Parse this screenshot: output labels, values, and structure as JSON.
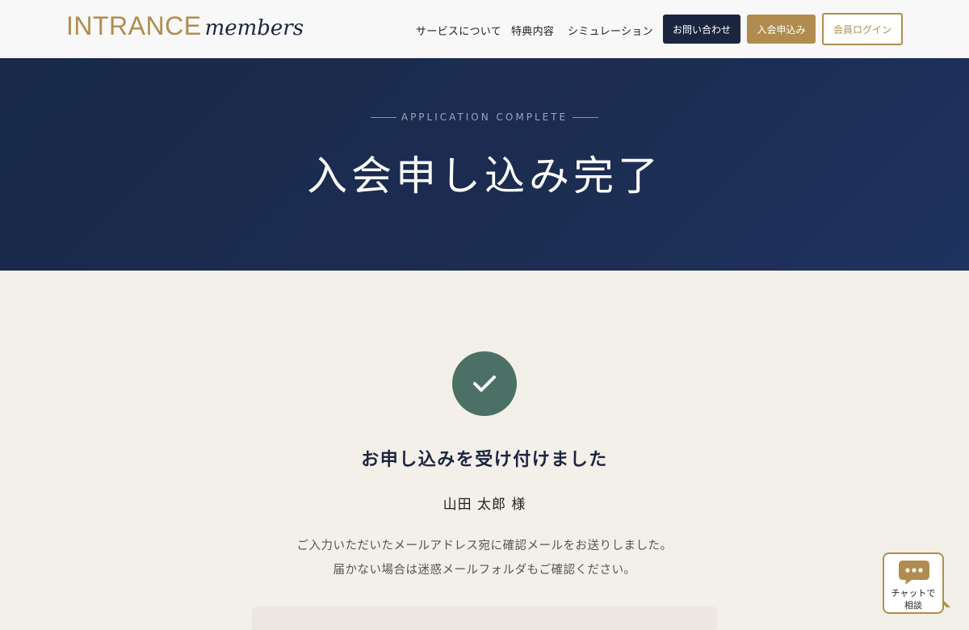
{
  "header": {
    "logo_main": "INTRANCE",
    "logo_sub": "members",
    "nav": [
      {
        "label": "サービスについて"
      },
      {
        "label": "特典内容"
      },
      {
        "label": "シミュレーション"
      }
    ],
    "contact_label": "お問い合わせ",
    "apply_label": "入会申込み",
    "login_label": "会員ログイン"
  },
  "hero": {
    "eyebrow": "APPLICATION COMPLETE",
    "title": "入会申し込み完了"
  },
  "main": {
    "check_icon": "checkmark-icon",
    "title": "お申し込みを受け付けました",
    "user_name": "山田 太郎 様",
    "message_line1": "ご入力いただいたメールアドレス宛に確認メールをお送りしました。",
    "message_line2": "届かない場合は迷惑メールフォルダもご確認ください。"
  },
  "chat": {
    "icon": "chat-bubble-icon",
    "label": "チャットで\n相談"
  },
  "colors": {
    "navy": "#1c2540",
    "gold": "#b08d4f",
    "green": "#4b7166",
    "background": "#f3efe9"
  }
}
